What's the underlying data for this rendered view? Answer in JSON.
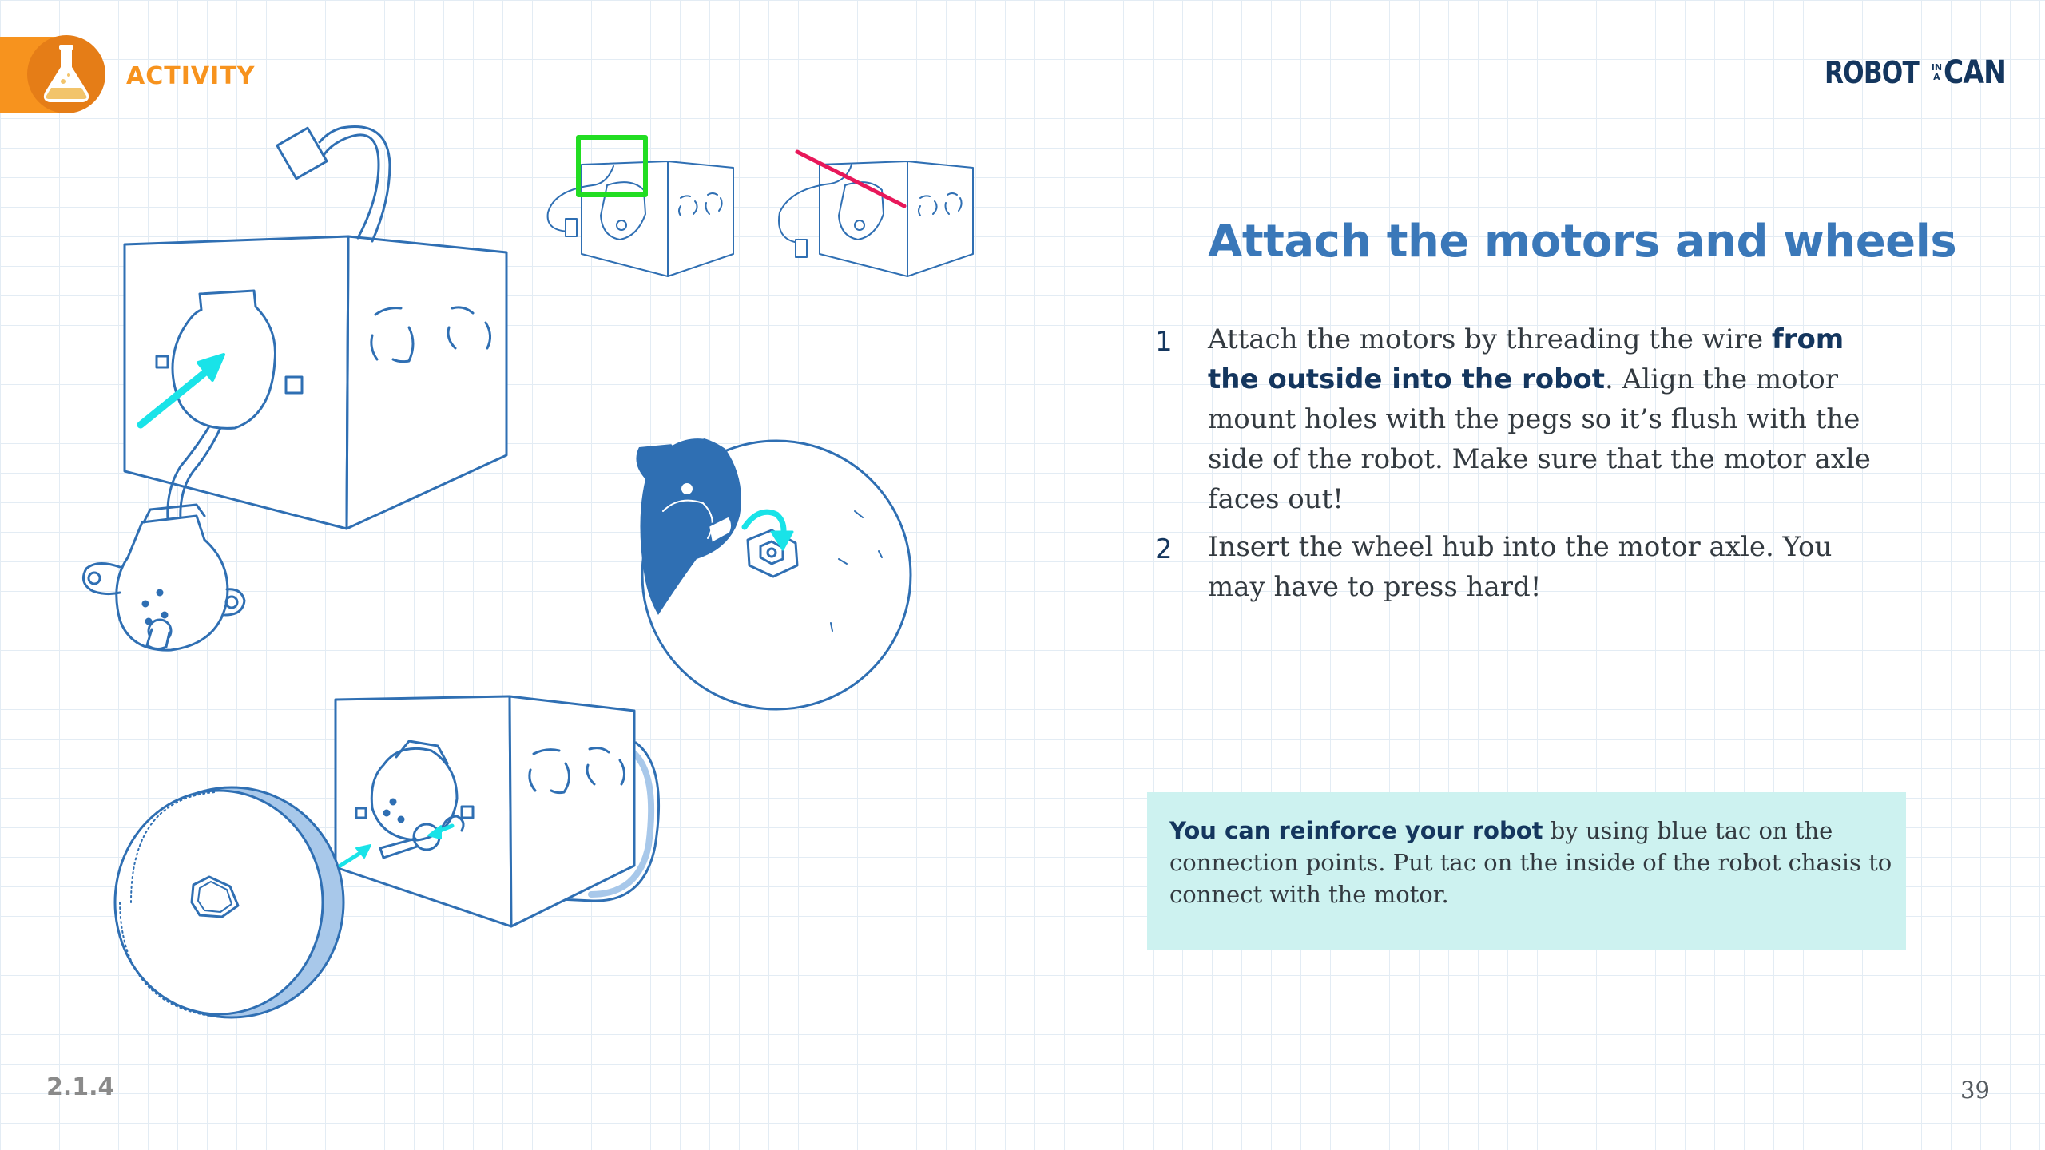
{
  "header": {
    "badge_label": "ACTIVITY",
    "badge_icon": "flask-icon",
    "logo": {
      "word1": "ROBOT",
      "small_top": "IN",
      "small_bottom": "A",
      "word2": "CAN"
    }
  },
  "content": {
    "title": "Attach the motors and wheels",
    "steps": [
      {
        "number": "1",
        "text_before": "Attach the motors by threading the wire ",
        "bold": "from the outside into the robot",
        "text_after": ". Align the motor mount holes with the pegs so it’s flush with the side of the robot. Make sure that the motor axle faces out!"
      },
      {
        "number": "2",
        "text_before": "Insert the wheel hub into the motor axle. You may have to press hard!"
      }
    ],
    "tip": {
      "bold": "You can reinforce your robot",
      "text": " by using blue tac on the connection points. Put tac on the inside of the robot chasis to connect with the motor."
    }
  },
  "footer": {
    "section": "2.1.4",
    "page": "39"
  },
  "colors": {
    "accent_orange": "#f7931e",
    "title_blue": "#3a78b9",
    "navy": "#14365e",
    "line_blue": "#2f6fb3",
    "arrow_cyan": "#19e3e8",
    "highlight_green": "#22dd22",
    "cross_pink": "#e8185a",
    "tip_bg": "#cdf2f0"
  }
}
